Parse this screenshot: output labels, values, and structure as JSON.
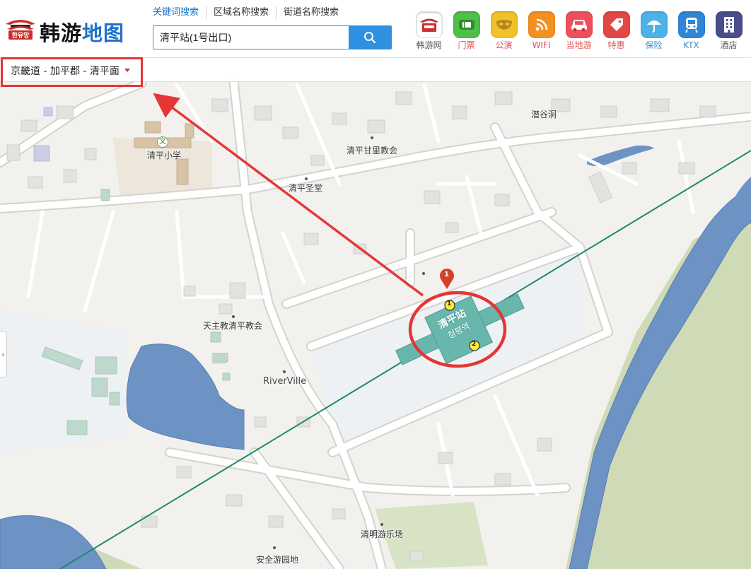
{
  "logo": {
    "brand_dark": "韩游",
    "brand_blue": "地图"
  },
  "search": {
    "tabs": [
      "关键词搜索",
      "区域名称搜索",
      "街道名称搜索"
    ],
    "value": "清平站(1号出口)"
  },
  "nav": [
    {
      "label": "韩游网",
      "icon": "hanyou-pagoda-icon",
      "color": "#ffffff",
      "label_color": "#555555"
    },
    {
      "label": "门票",
      "icon": "ticket-icon",
      "color": "#4fbf48",
      "label_color": "#e05555"
    },
    {
      "label": "公演",
      "icon": "mask-icon",
      "color": "#f0c22a",
      "label_color": "#e05555"
    },
    {
      "label": "WIFI",
      "icon": "wifi-icon",
      "color": "#f29120",
      "label_color": "#e05555"
    },
    {
      "label": "当地游",
      "icon": "car-icon",
      "color": "#ee4f5c",
      "label_color": "#e05555"
    },
    {
      "label": "特惠",
      "icon": "tag-icon",
      "color": "#e24745",
      "label_color": "#e05555"
    },
    {
      "label": "保险",
      "icon": "umbrella-icon",
      "color": "#4cb2e8",
      "label_color": "#3f8dd0"
    },
    {
      "label": "KTX",
      "icon": "train-icon",
      "color": "#2f86d6",
      "label_color": "#3f8dd0"
    },
    {
      "label": "酒店",
      "icon": "building-icon",
      "color": "#4a4d8c",
      "label_color": "#555555"
    }
  ],
  "region": {
    "label": "京畿道 - 加平郡 - 清平面"
  },
  "map": {
    "places": {
      "school": "清平小学",
      "school_badge": "文",
      "church1": "清平甘里教会",
      "church2": "清平圣堂",
      "village": "潜谷洞",
      "catholic": "天主教清平教会",
      "riverville": "RiverVille",
      "park": "清明游乐场",
      "park2": "安全游园地"
    },
    "station": {
      "name": "清平站",
      "name_ko": "청평역",
      "exit1": "1",
      "exit2": "2",
      "marker": "1"
    },
    "colors": {
      "water": "#6d93c4",
      "station": "#69b6ad",
      "rail": "#1e8a68",
      "annotation": "#e63535"
    }
  }
}
